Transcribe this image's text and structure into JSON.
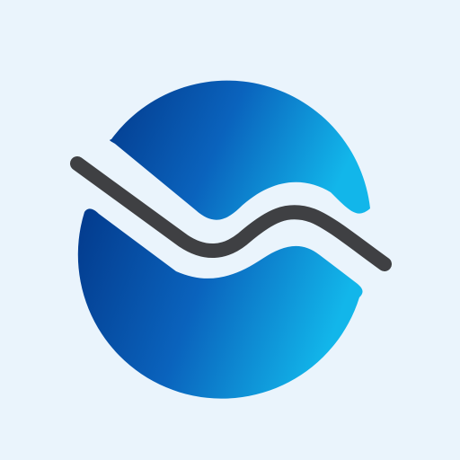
{
  "logo": {
    "icon": "wave-globe-logo",
    "colors": {
      "background": "#eaf4fc",
      "globe_dark": "#033a8c",
      "globe_mid": "#0a63bd",
      "globe_light": "#12b6ea",
      "wave_stroke": "#3f4043"
    }
  }
}
